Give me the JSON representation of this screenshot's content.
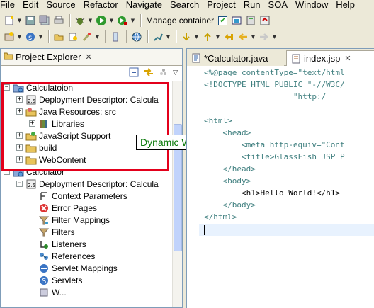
{
  "menubar": [
    "File",
    "Edit",
    "Source",
    "Refactor",
    "Navigate",
    "Search",
    "Project",
    "Run",
    "SOA",
    "Window",
    "Help"
  ],
  "toolbar": {
    "manage_container_label": "Manage container"
  },
  "explorer": {
    "title": "Project Explorer",
    "rows": [
      {
        "label": "Calculatoion",
        "icon": "web-project-icon",
        "expander": "−"
      },
      {
        "label": "Deployment Descriptor: Calcula",
        "icon": "descriptor-icon",
        "expander": "+"
      },
      {
        "label": "Java Resources: src",
        "icon": "java-resources-icon",
        "expander": "+"
      },
      {
        "label": "Libraries",
        "icon": "library-icon",
        "expander": "+"
      },
      {
        "label": "JavaScript Support",
        "icon": "js-support-icon",
        "expander": "+"
      },
      {
        "label": "build",
        "icon": "folder-icon",
        "expander": "+"
      },
      {
        "label": "WebContent",
        "icon": "folder-icon",
        "expander": "+"
      },
      {
        "label": "Calculator",
        "icon": "web-project-icon",
        "expander": "−"
      },
      {
        "label": "Deployment Descriptor: Calcula",
        "icon": "descriptor-icon",
        "expander": "−"
      },
      {
        "label": "Context Parameters",
        "icon": "context-param-icon",
        "expander": ""
      },
      {
        "label": "Error Pages",
        "icon": "error-page-icon",
        "expander": ""
      },
      {
        "label": "Filter Mappings",
        "icon": "filter-mapping-icon",
        "expander": ""
      },
      {
        "label": "Filters",
        "icon": "filter-icon",
        "expander": ""
      },
      {
        "label": "Listeners",
        "icon": "listener-icon",
        "expander": ""
      },
      {
        "label": "References",
        "icon": "reference-icon",
        "expander": ""
      },
      {
        "label": "Servlet Mappings",
        "icon": "servlet-mapping-icon",
        "expander": ""
      },
      {
        "label": "Servlets",
        "icon": "servlet-icon",
        "expander": ""
      },
      {
        "label": "W...",
        "icon": "welcome-icon",
        "expander": ""
      }
    ]
  },
  "tooltip": "Dynamic Web Project 생성",
  "editor": {
    "tabs": [
      {
        "label": "*Calculator.java",
        "active": false
      },
      {
        "label": "index.jsp",
        "active": true
      }
    ],
    "lines": [
      "<%@page contentType=\"text/html",
      "<!DOCTYPE HTML PUBLIC \"-//W3C/",
      "                   \"http:/",
      "",
      "<html>",
      "    <head>",
      "        <meta http-equiv=\"Cont",
      "        <title>GlassFish JSP P",
      "    </head>",
      "    <body>",
      "        <h1>Hello World!</h1>",
      "    </body>",
      "</html>"
    ]
  },
  "colors": {
    "highlight": "#e3001b",
    "tooltip_text": "#0b7a0b",
    "selection_blue": "#316ac5"
  }
}
